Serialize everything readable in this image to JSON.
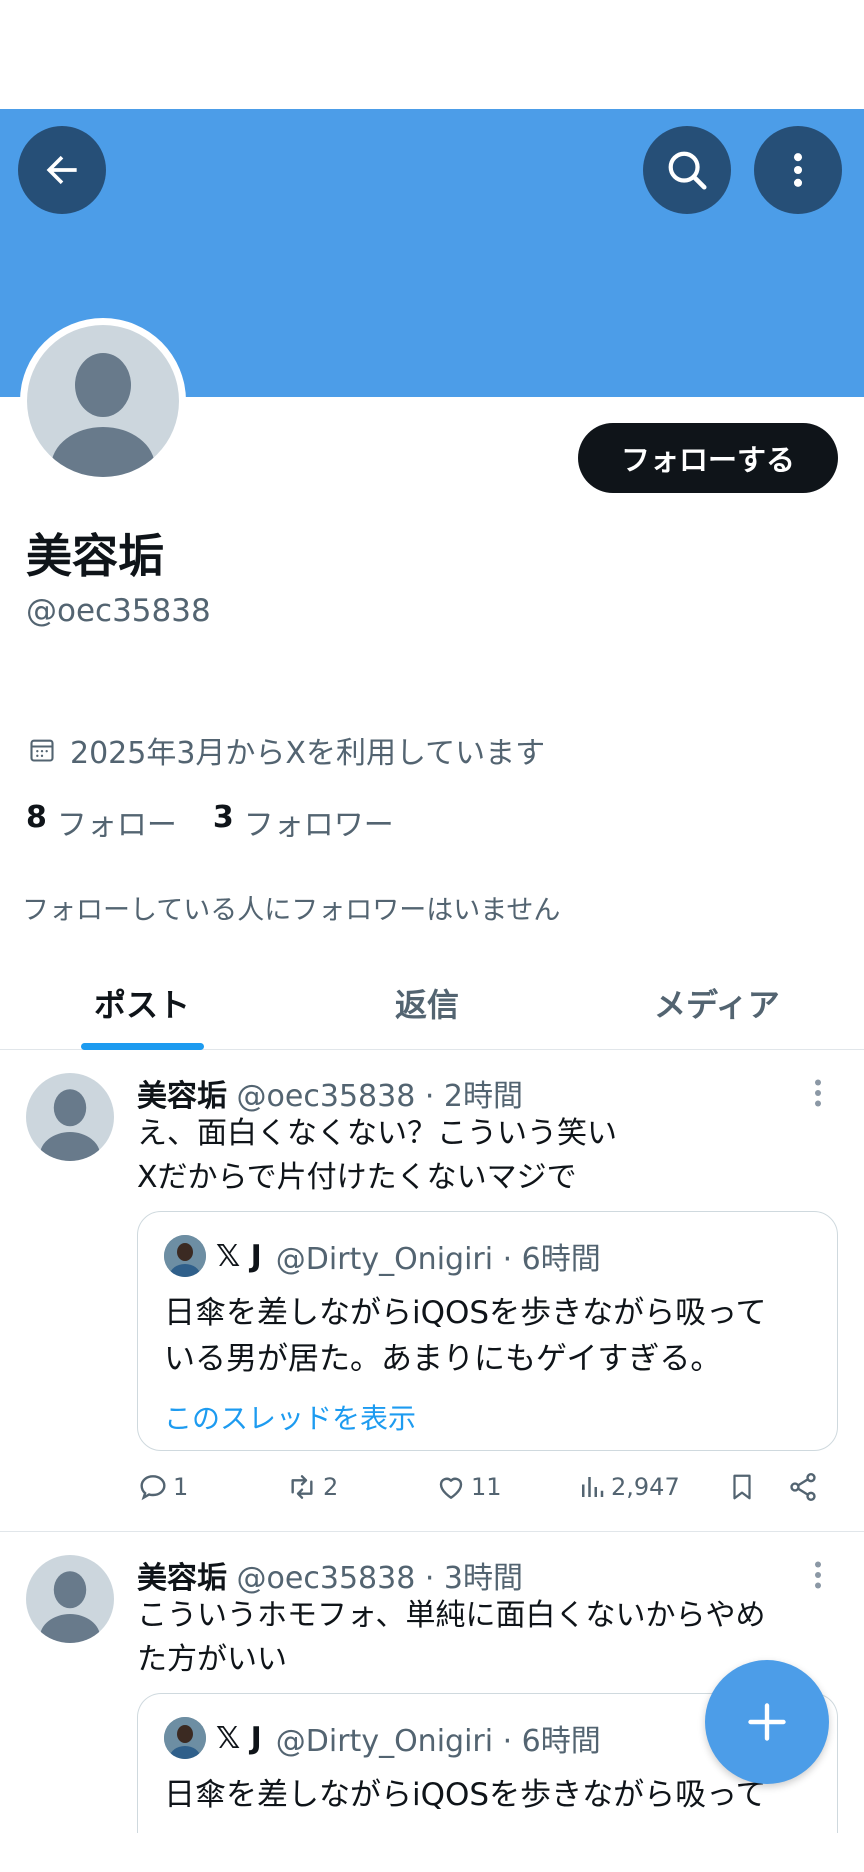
{
  "colors": {
    "banner": "#4c9de8",
    "accent": "#1d9bf0",
    "button_dark": "#0f1419",
    "muted_text": "#536471"
  },
  "header": {
    "back_icon": "arrow-left-icon",
    "search_icon": "search-icon",
    "more_icon": "more-vertical-icon"
  },
  "profile": {
    "display_name": "美容垢",
    "handle": "@oec35838",
    "follow_label": "フォローする",
    "joined": "2025年3月からXを利用しています",
    "following_count": "8",
    "following_label": "フォロー",
    "followers_count": "3",
    "followers_label": "フォロワー",
    "mutual_note": "フォローしている人にフォロワーはいません"
  },
  "tabs": [
    {
      "label": "ポスト",
      "active": true
    },
    {
      "label": "返信",
      "active": false
    },
    {
      "label": "メディア",
      "active": false
    }
  ],
  "posts": [
    {
      "name": "美容垢",
      "meta": "@oec35838 · 2時間",
      "text_lines": [
        "え、面白くなくない？こういう笑い",
        "Xだからで片付けたくないマジで"
      ],
      "quote": {
        "name": "𝕏 J",
        "meta": "@Dirty_Onigiri · 6時間",
        "text_lines": [
          "日傘を差しながらiQOSを歩きながら吸って",
          "いる男が居た。あまりにもゲイすぎる。"
        ],
        "thread_link": "このスレッドを表示"
      },
      "actions": {
        "replies": "1",
        "reposts": "2",
        "likes": "11",
        "views": "2,947"
      }
    },
    {
      "name": "美容垢",
      "meta": "@oec35838 · 3時間",
      "text_lines": [
        "こういうホモフォ、単純に面白くないからやめ",
        "た方がいい"
      ],
      "quote": {
        "name": "𝕏 J",
        "meta": "@Dirty_Onigiri · 6時間",
        "text_lines": [
          "日傘を差しながらiQOSを歩きながら吸って"
        ]
      }
    }
  ],
  "fab": {
    "icon": "plus-icon"
  }
}
